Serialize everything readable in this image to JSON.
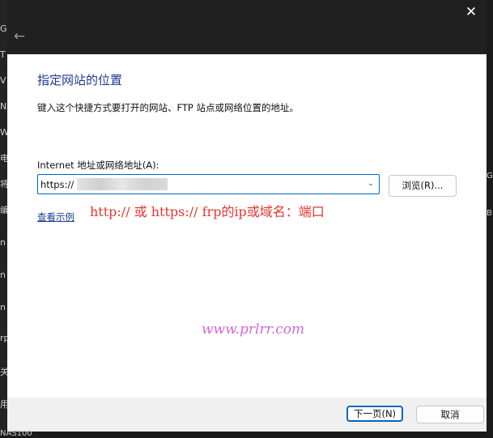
{
  "background": {
    "left_chars": [
      "G",
      "T",
      "V",
      "N",
      "W",
      "电",
      "将",
      "编",
      "n",
      "n",
      "n",
      "rp",
      "关",
      "用"
    ],
    "bottom_text": "NAS100",
    "right_chars": [
      "Gi",
      "B"
    ]
  },
  "titlebar": {
    "back_icon": "back-arrow-icon",
    "close_icon": "close-icon"
  },
  "dialog": {
    "heading": "指定网站的位置",
    "instruction": "键入这个快捷方式要打开的网站、FTP 站点或网络位置的地址。",
    "field_label": "Internet 地址或网络地址(A):",
    "url_value": "https://",
    "browse_label": "浏览(R)...",
    "example_link": "查看示例",
    "annotation": "http://  或  https://      frp的ip或域名：端口",
    "watermark": "www.prlrr.com"
  },
  "footer": {
    "next_label": "下一页(N)",
    "cancel_label": "取消"
  },
  "colors": {
    "heading": "#1c3a8f",
    "link": "#1c3a8f",
    "accent": "#0067c0",
    "annotation": "#e8352e",
    "watermark": "#d567d8"
  }
}
